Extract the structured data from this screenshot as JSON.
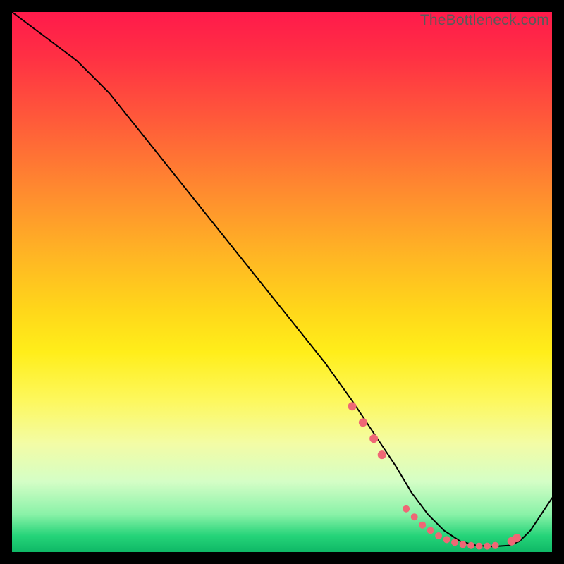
{
  "watermark": "TheBottleneck.com",
  "colors": {
    "dot": "#ef6775",
    "curve": "#000000",
    "frame": "#000000"
  },
  "chart_data": {
    "type": "line",
    "title": "",
    "xlabel": "",
    "ylabel": "",
    "xlim": [
      0,
      100
    ],
    "ylim": [
      0,
      100
    ],
    "grid": false,
    "legend": false,
    "series": [
      {
        "name": "bottleneck-curve",
        "x": [
          0,
          4,
          8,
          12,
          18,
          26,
          34,
          42,
          50,
          58,
          63,
          67,
          71,
          74,
          77,
          80,
          83,
          86,
          89,
          92,
          94,
          96,
          98,
          100
        ],
        "y": [
          100,
          97,
          94,
          91,
          85,
          75,
          65,
          55,
          45,
          35,
          28,
          22,
          16,
          11,
          7,
          4,
          2,
          1.2,
          1,
          1.2,
          2,
          4,
          7,
          10
        ]
      }
    ],
    "highlighted_points": {
      "name": "dots",
      "x": [
        63,
        65,
        67,
        68.5,
        73,
        74.5,
        76,
        77.5,
        79,
        80.5,
        82,
        83.5,
        85,
        86.5,
        88,
        89.5,
        92.5,
        93.5
      ],
      "y": [
        27,
        24,
        21,
        18,
        8,
        6.5,
        5,
        4,
        3,
        2.3,
        1.8,
        1.4,
        1.2,
        1.1,
        1.1,
        1.2,
        2.0,
        2.6
      ],
      "r": [
        6,
        6,
        6,
        6,
        5,
        5,
        5,
        5,
        5,
        5,
        5,
        5,
        5,
        5,
        5,
        5,
        6,
        6
      ]
    }
  }
}
